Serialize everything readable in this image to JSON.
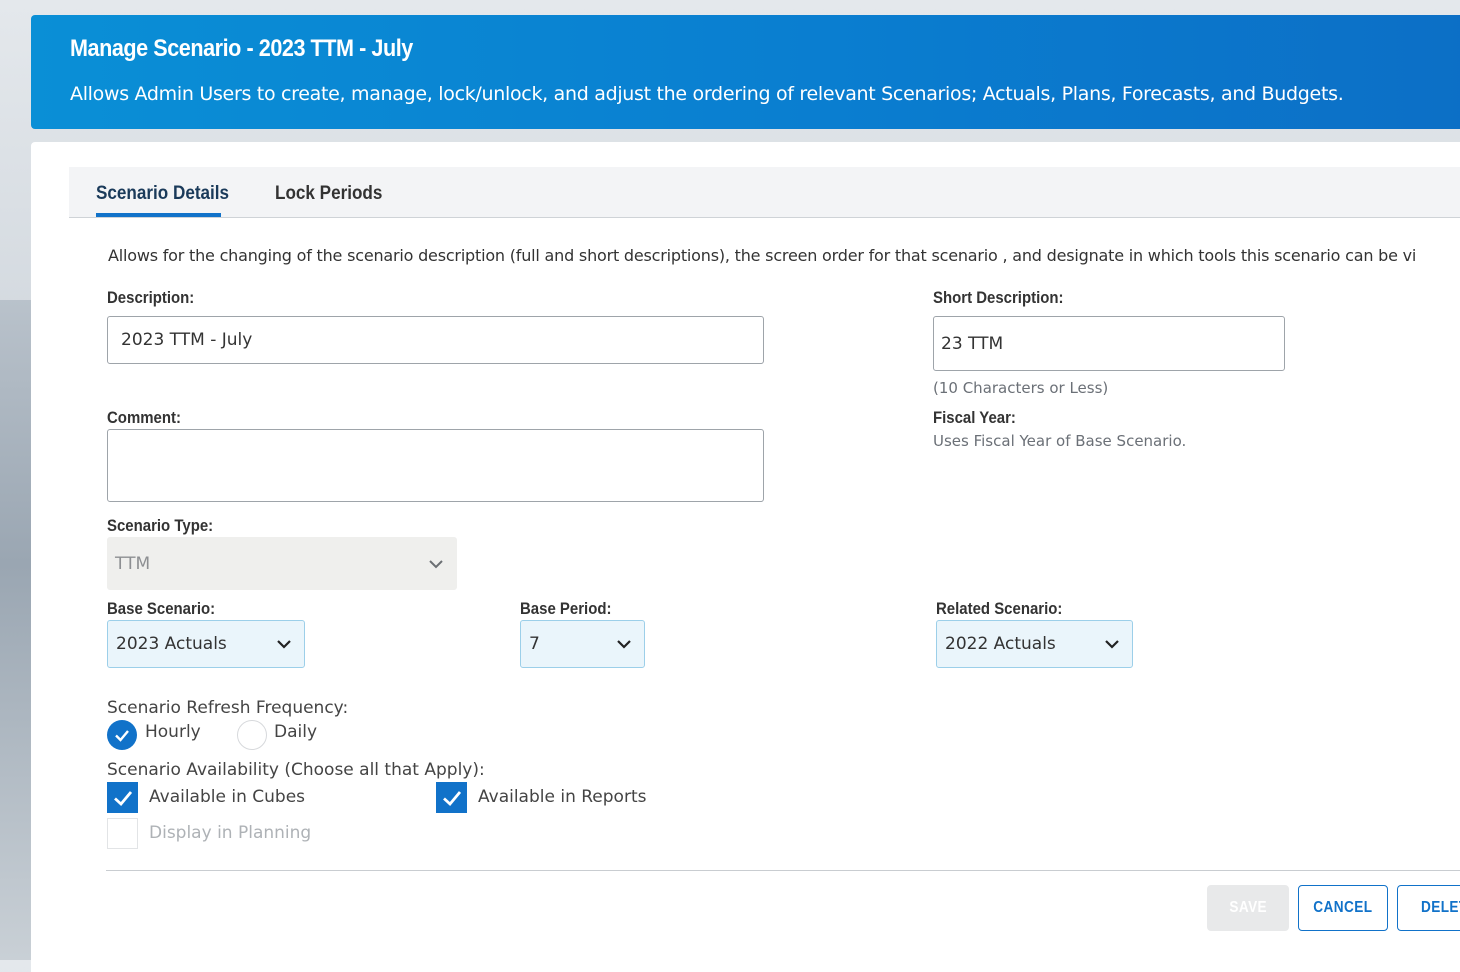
{
  "header": {
    "title": "Manage Scenario - 2023 TTM - July",
    "subtitle": "Allows Admin Users to create, manage, lock/unlock, and adjust the ordering of relevant Scenarios; Actuals, Plans, Forecasts, and Budgets."
  },
  "tabs": [
    {
      "label": "Scenario Details",
      "active": true
    },
    {
      "label": "Lock Periods",
      "active": false
    }
  ],
  "intro": "Allows for the changing of the scenario description (full and short descriptions), the screen order for that scenario , and designate in which tools this scenario can be vi",
  "form": {
    "description_label": "Description:",
    "description_value": "2023 TTM - July",
    "short_description_label": "Short Description:",
    "short_description_value": "23 TTM",
    "short_description_hint": "(10 Characters or Less)",
    "comment_label": "Comment:",
    "comment_value": "",
    "fiscal_year_label": "Fiscal Year:",
    "fiscal_year_note": "Uses Fiscal Year of Base Scenario.",
    "scenario_type_label": "Scenario Type:",
    "scenario_type_value": "TTM",
    "base_scenario_label": "Base Scenario:",
    "base_scenario_value": "2023 Actuals",
    "base_period_label": "Base Period:",
    "base_period_value": "7",
    "related_scenario_label": "Related Scenario:",
    "related_scenario_value": "2022 Actuals",
    "refresh_label": "Scenario Refresh Frequency:",
    "refresh_options": [
      {
        "label": "Hourly",
        "selected": true
      },
      {
        "label": "Daily",
        "selected": false
      }
    ],
    "availability_label": "Scenario Availability (Choose all that Apply):",
    "availability_options": [
      {
        "label": "Available in Cubes",
        "checked": true,
        "enabled": true
      },
      {
        "label": "Available in Reports",
        "checked": true,
        "enabled": true
      },
      {
        "label": "Display in Planning",
        "checked": false,
        "enabled": false
      }
    ]
  },
  "buttons": {
    "save": "SAVE",
    "cancel": "CANCEL",
    "delete": "DELETE"
  },
  "colors": {
    "accent": "#1172c9",
    "header": "#0a86d3"
  }
}
